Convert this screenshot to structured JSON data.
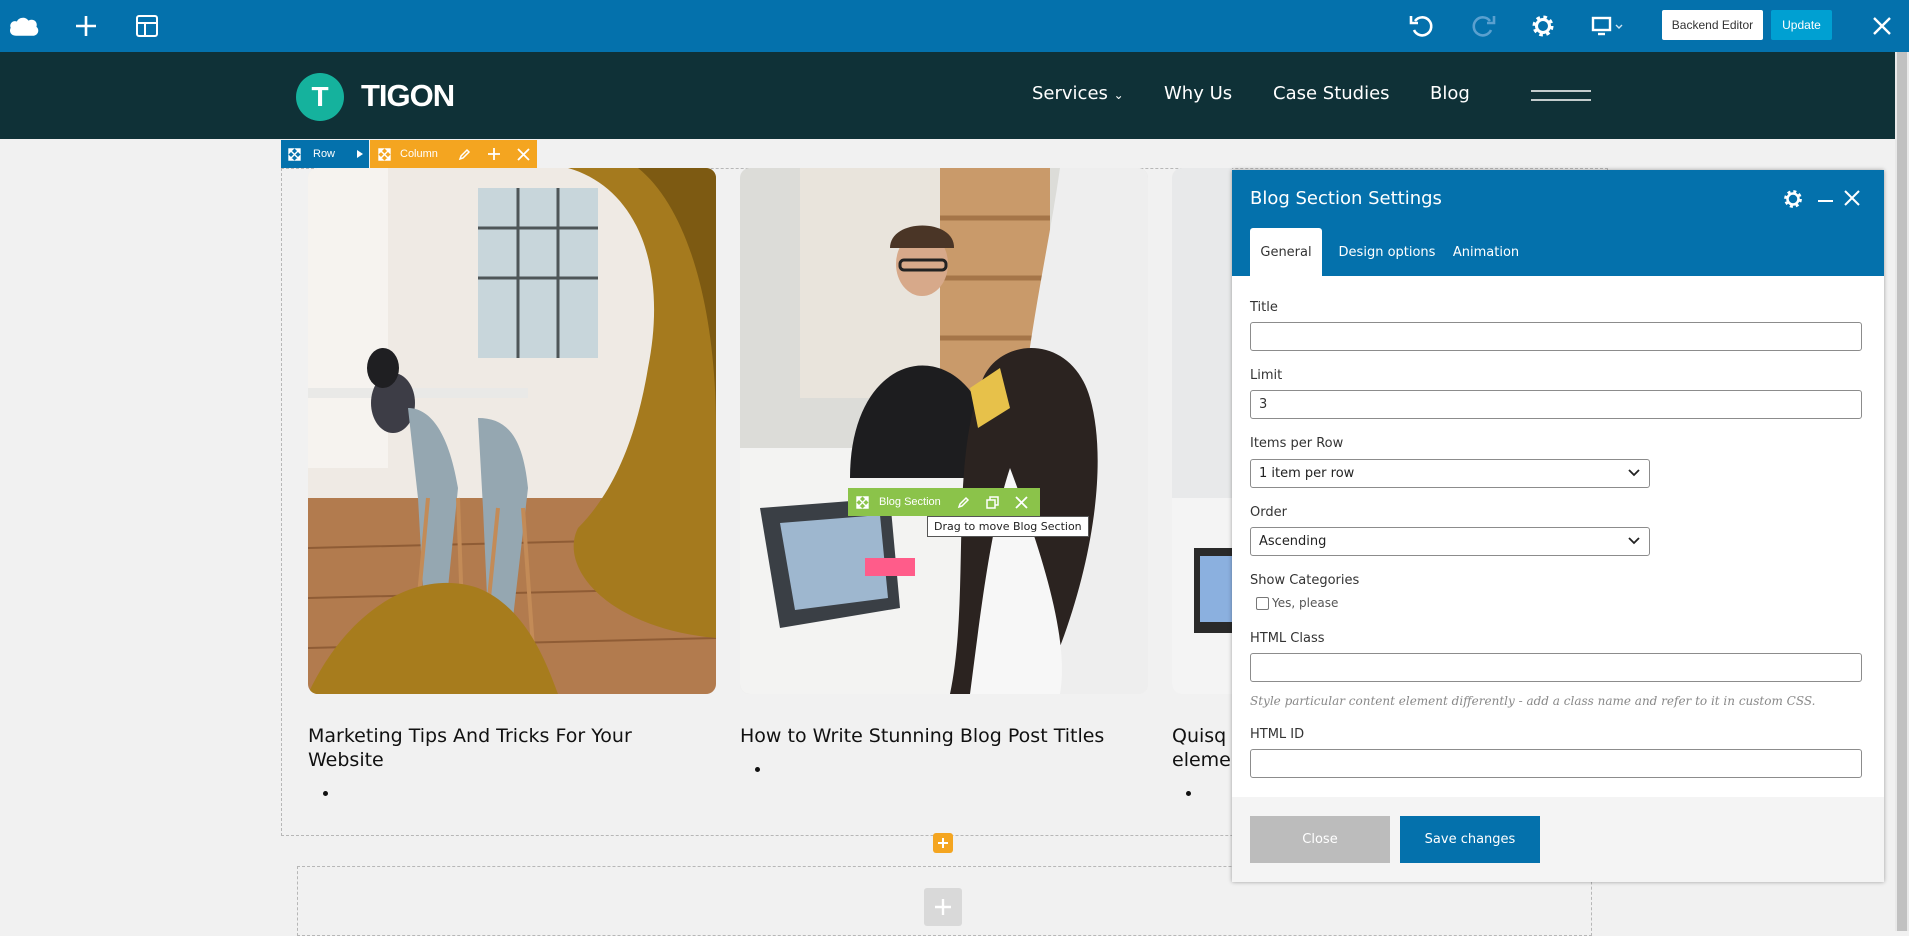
{
  "topbar": {
    "backend_editor_label": "Backend Editor",
    "update_label": "Update"
  },
  "site": {
    "logo_letter": "T",
    "logo_text": "TIGON",
    "nav": [
      "Services",
      "Why Us",
      "Case Studies",
      "Blog"
    ]
  },
  "controls": {
    "row_label": "Row",
    "column_label": "Column",
    "blog_section_label": "Blog Section",
    "drag_tooltip": "Drag to move Blog Section"
  },
  "posts": [
    {
      "title_line1": "Marketing Tips And Tricks For Your",
      "title_line2": "Website"
    },
    {
      "title_line1": "How to Write Stunning Blog Post Titles",
      "title_line2": ""
    },
    {
      "title_line1": "Quisq",
      "title_line2": "eleme"
    }
  ],
  "dialog": {
    "title": "Blog Section Settings",
    "tabs": [
      "General",
      "Design options",
      "Animation"
    ],
    "fields": {
      "title_label": "Title",
      "title_value": "",
      "limit_label": "Limit",
      "limit_value": "3",
      "items_per_row_label": "Items per Row",
      "items_per_row_value": "1 item per row",
      "order_label": "Order",
      "order_value": "Ascending",
      "show_categories_label": "Show Categories",
      "show_categories_option": "Yes, please",
      "html_class_label": "HTML Class",
      "html_class_value": "",
      "html_class_help": "Style particular content element differently - add a class name and refer to it in custom CSS.",
      "html_id_label": "HTML ID",
      "html_id_value": ""
    },
    "close_label": "Close",
    "save_label": "Save changes"
  },
  "colors": {
    "builder_blue": "#0471ac",
    "header_dark": "#0f3137",
    "logo_teal": "#15b29d",
    "row_blue": "#0471ac",
    "column_orange": "#f4a520",
    "section_green": "#8bc34a",
    "update_blue": "#00a0d2"
  }
}
